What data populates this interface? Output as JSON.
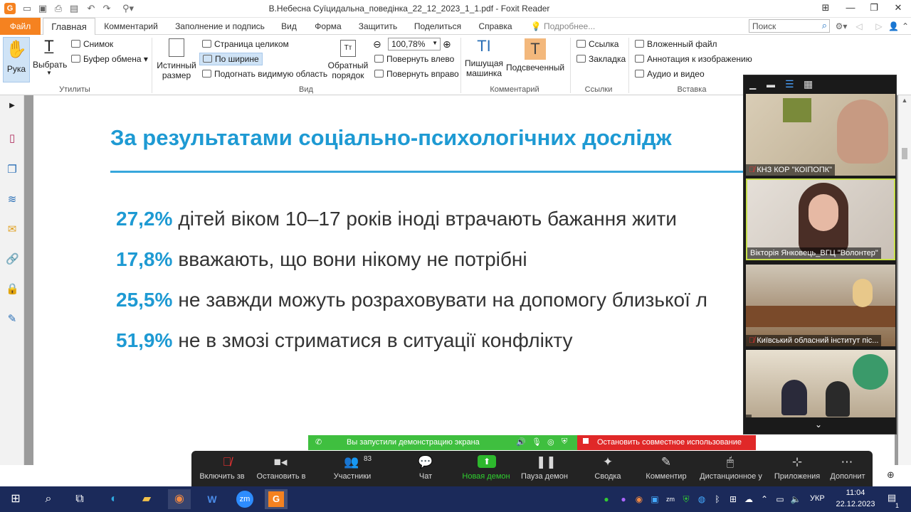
{
  "window": {
    "title": "В.Небесна Суїцидальна_поведінка_22_12_2023_1_1.pdf - Foxit Reader"
  },
  "menu": {
    "tabs": [
      "Файл",
      "Главная",
      "Комментарий",
      "Заполнение и подпись",
      "Вид",
      "Форма",
      "Защитить",
      "Поделиться",
      "Справка"
    ],
    "tell_me": "Подробнее...",
    "search_placeholder": "Поиск"
  },
  "ribbon": {
    "hand": "Рука",
    "select": "Выбрать",
    "snapshot": "Снимок",
    "clipboard": "Буфер обмена",
    "group_tools": "Утилиты",
    "actual_size_1": "Истинный",
    "actual_size_2": "размер",
    "fit_page": "Страница целиком",
    "fit_width": "По ширине",
    "fit_visible": "Подогнать видимую область",
    "reflow_1": "Обратный",
    "reflow_2": "порядок",
    "zoom_value": "100,78%",
    "rotate_left": "Повернуть влево",
    "rotate_right": "Повернуть вправо",
    "group_view": "Вид",
    "typewriter_1": "Пишущая",
    "typewriter_2": "машинка",
    "highlight": "Подсвеченный",
    "group_comment": "Комментарий",
    "link": "Ссылка",
    "bookmark": "Закладка",
    "group_links": "Ссылки",
    "attach_file": "Вложенный файл",
    "image_annotation": "Аннотация к изображению",
    "audio_video": "Аудио и видео",
    "group_insert": "Вставка"
  },
  "slide": {
    "title": "За результатами соціально-психологічних дослідж",
    "stats": [
      {
        "pct": "27,2%",
        "text": "дітей віком 10–17 років іноді втрачають бажання жити"
      },
      {
        "pct": "17,8%",
        "text": "вважають, що вони нікому не потрібні"
      },
      {
        "pct": "25,5%",
        "text": "не завжди можуть розраховувати на допомогу близької л"
      },
      {
        "pct": "51,9%",
        "text": "не в змозі стриматися в ситуації конфлікту"
      }
    ]
  },
  "zoom": {
    "participants": [
      {
        "name": "КНЗ КОР \"КОІПОПК\""
      },
      {
        "name": "Вікторія Янковець_ВГЦ \"Волонтер\""
      },
      {
        "name": "Київський обласний інститут піс..."
      },
      {
        "name": ""
      }
    ],
    "share_notice": "Вы запустили демонстрацию экрана",
    "stop_share": "Остановить совместное использование",
    "controls": [
      {
        "label": "Включить зв",
        "icon": "mic-muted-icon"
      },
      {
        "label": "Остановить в",
        "icon": "video-icon"
      },
      {
        "label": "Участники",
        "icon": "participants-icon"
      },
      {
        "label": "Чат",
        "icon": "chat-icon"
      },
      {
        "label": "Новая демон",
        "icon": "share-icon"
      },
      {
        "label": "Пауза демон",
        "icon": "pause-icon"
      },
      {
        "label": "Сводка",
        "icon": "summary-icon"
      },
      {
        "label": "Комментир",
        "icon": "annotate-icon"
      },
      {
        "label": "Дистанционное у",
        "icon": "remote-control-icon"
      },
      {
        "label": "Приложения",
        "icon": "apps-icon"
      },
      {
        "label": "Дополнит",
        "icon": "more-icon"
      }
    ],
    "participant_count": "83"
  },
  "taskbar": {
    "lang": "УКР",
    "time": "11:04",
    "date": "22.12.2023",
    "notification_count": "1"
  },
  "colors": {
    "accent_orange": "#f58220",
    "slide_blue": "#1e9ad3",
    "share_green": "#3fbf3f",
    "stop_red": "#e02828"
  }
}
